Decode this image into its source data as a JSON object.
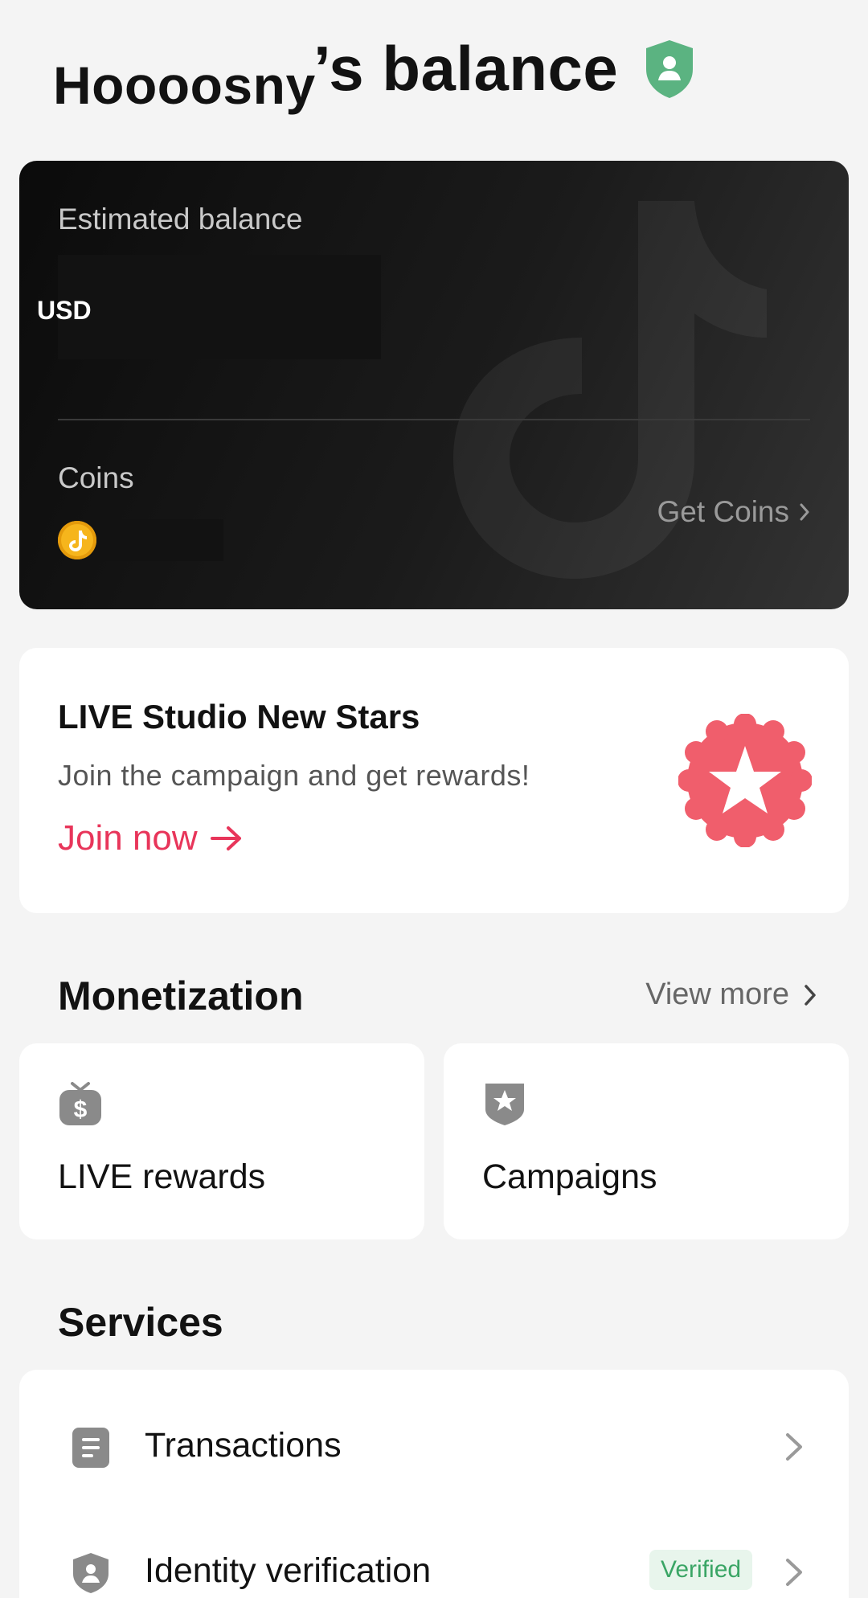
{
  "header": {
    "username": "Hoooosny",
    "title_suffix": "’s balance",
    "badge_icon": "shield-user-icon",
    "badge_color": "#5bb381"
  },
  "balance_card": {
    "estimated_label": "Estimated balance",
    "currency": "USD",
    "coins_label": "Coins",
    "coin_icon": "tiktok-coin-icon",
    "get_coins_label": "Get Coins",
    "accent": "#f6b51c"
  },
  "campaign": {
    "title": "LIVE Studio New Stars",
    "subtitle": "Join the campaign and get rewards!",
    "cta": "Join now",
    "badge_icon": "star-badge-icon",
    "cta_color": "#e8355a",
    "badge_color": "#f05e6c"
  },
  "monetization": {
    "title": "Monetization",
    "view_more": "View more",
    "tiles": [
      {
        "label": "LIVE rewards",
        "icon": "money-bag-icon"
      },
      {
        "label": "Campaigns",
        "icon": "star-shield-icon"
      }
    ]
  },
  "services": {
    "title": "Services",
    "items": [
      {
        "label": "Transactions",
        "icon": "document-icon"
      },
      {
        "label": "Identity verification",
        "icon": "shield-user-icon",
        "badge": "Verified"
      }
    ]
  }
}
